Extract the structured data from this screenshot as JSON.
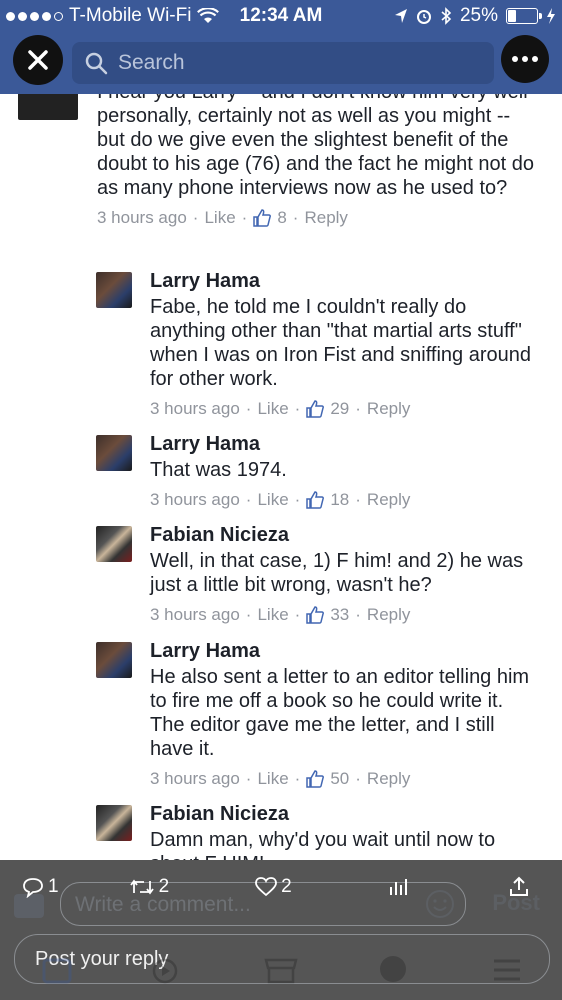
{
  "status_bar": {
    "carrier": "T-Mobile Wi-Fi",
    "time": "12:34 AM",
    "battery": "25%",
    "battery_level": 0.25
  },
  "nav": {
    "search_placeholder": "Search",
    "close_icon": "close-icon",
    "more_icon": "more-icon"
  },
  "comments": [
    {
      "author": "",
      "body": "I hear you Larry -- and I don't know him very well personally, certainly not as well as you might -- but do we give even the slightest benefit of the doubt to his age (76) and the fact he might not do as many phone interviews now as he used to?",
      "time": "3 hours ago",
      "like": "Like",
      "likes": "8",
      "reply": "Reply"
    },
    {
      "author": "Larry Hama",
      "body": "Fabe, he told me I couldn't really do anything other than \"that martial arts stuff\" when I was on Iron Fist and sniffing around for other work.",
      "time": "3 hours ago",
      "like": "Like",
      "likes": "29",
      "reply": "Reply"
    },
    {
      "author": "Larry Hama",
      "body": "That was 1974.",
      "time": "3 hours ago",
      "like": "Like",
      "likes": "18",
      "reply": "Reply"
    },
    {
      "author": "Fabian Nicieza",
      "body": "Well, in that case, 1) F him! and 2) he was just a little bit wrong, wasn't he?",
      "time": "3 hours ago",
      "like": "Like",
      "likes": "33",
      "reply": "Reply"
    },
    {
      "author": "Larry Hama",
      "body": "He also sent a letter to an editor telling him to fire me off a book so he could write it.  The editor gave me the letter, and I still have it.",
      "time": "3 hours ago",
      "like": "Like",
      "likes": "50",
      "reply": "Reply"
    },
    {
      "author": "Fabian Nicieza",
      "body": "Damn man, why'd you wait until now to shout F HIM!",
      "time": "",
      "like": "",
      "likes": "",
      "reply": ""
    }
  ],
  "composer": {
    "write_placeholder": "Write a comment...",
    "post_label": "Post",
    "reply_placeholder": "Post your reply"
  },
  "twitter_actions": {
    "replies": "1",
    "retweets": "2",
    "likes": "2"
  },
  "colors": {
    "brand": "#3b5998",
    "text": "#1d2129",
    "meta": "#90949c",
    "like_icon": "#4267b2"
  }
}
